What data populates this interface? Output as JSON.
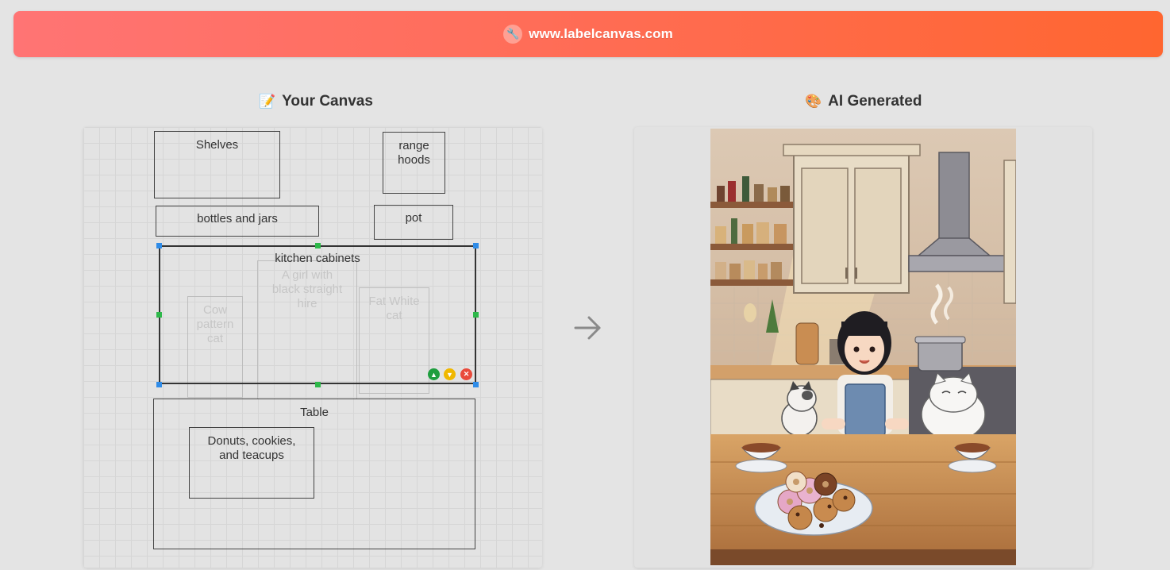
{
  "banner": {
    "icon": "wrench-icon",
    "url": "www.labelcanvas.com"
  },
  "canvas_section": {
    "title": "Your Canvas",
    "icon": "pencil-icon"
  },
  "ai_section": {
    "title": "AI Generated",
    "icon": "palette-icon"
  },
  "arrow": {
    "icon": "arrow-right-icon"
  },
  "canvas": {
    "shelves": "Shelves",
    "range_hoods": "range\nhoods",
    "bottles": "bottles and jars",
    "pot": "pot",
    "kitchen_cabinets": "kitchen cabinets",
    "girl": "A girl with\nblack straight\nhire",
    "cow_cat": "Cow\npattern\ncat",
    "fat_cat": "Fat White\ncat",
    "table": "Table",
    "donuts": "Donuts, cookies,\nand teacups"
  },
  "controls": {
    "up_icon": "chevron-up-icon",
    "down_icon": "chevron-down-icon",
    "delete_icon": "delete-icon"
  },
  "colors": {
    "banner_start": "#ff7474",
    "banner_end": "#ff6630",
    "handle_blue": "#2f8ce8",
    "handle_green": "#2eb84a"
  }
}
